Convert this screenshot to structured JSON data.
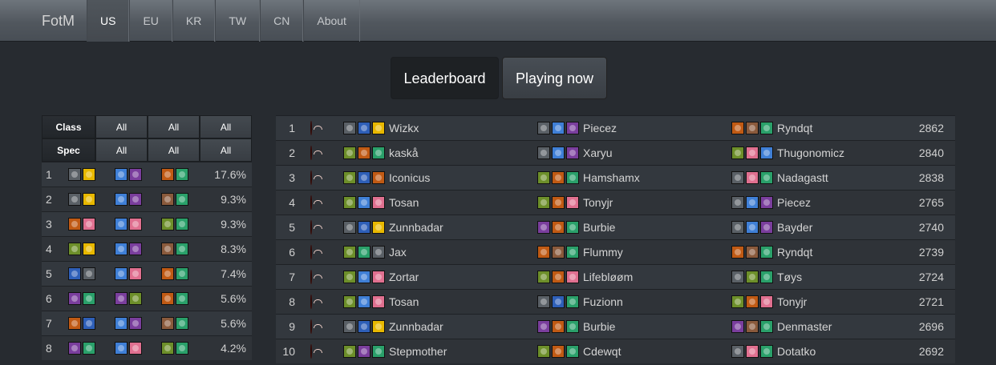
{
  "brand": "FotM",
  "nav": [
    {
      "label": "US",
      "active": true
    },
    {
      "label": "EU",
      "active": false
    },
    {
      "label": "KR",
      "active": false
    },
    {
      "label": "TW",
      "active": false
    },
    {
      "label": "CN",
      "active": false
    },
    {
      "label": "About",
      "active": false
    }
  ],
  "toggles": {
    "leaderboard": "Leaderboard",
    "playing_now": "Playing now"
  },
  "filters": {
    "class_label": "Class",
    "spec_label": "Spec",
    "class_opts": [
      "All",
      "All",
      "All"
    ],
    "spec_opts": [
      "All",
      "All",
      "All"
    ]
  },
  "colors": {
    "dk": "#5a6066",
    "rogue": "#e8b800",
    "hunter": "#6d8f2a",
    "mage": "#3f7fd6",
    "lock": "#7a3e9d",
    "priest": "#c8c8c8",
    "paladin": "#e07090",
    "druid": "#c05a14",
    "shaman": "#2e5fb8",
    "warrior": "#8a5a3c",
    "monk": "#2aa06a",
    "horde": "#8b1a14"
  },
  "comps": [
    {
      "rank": "1",
      "pct": "17.6%",
      "icons": [
        [
          "dk",
          "rogue"
        ],
        [
          "mage",
          "lock"
        ],
        [
          "druid",
          "monk"
        ]
      ]
    },
    {
      "rank": "2",
      "pct": "9.3%",
      "icons": [
        [
          "dk",
          "rogue"
        ],
        [
          "mage",
          "lock"
        ],
        [
          "warrior",
          "monk"
        ]
      ]
    },
    {
      "rank": "3",
      "pct": "9.3%",
      "icons": [
        [
          "druid",
          "paladin"
        ],
        [
          "mage",
          "paladin"
        ],
        [
          "hunter",
          "monk"
        ]
      ]
    },
    {
      "rank": "4",
      "pct": "8.3%",
      "icons": [
        [
          "hunter",
          "rogue"
        ],
        [
          "mage",
          "lock"
        ],
        [
          "warrior",
          "monk"
        ]
      ]
    },
    {
      "rank": "5",
      "pct": "7.4%",
      "icons": [
        [
          "shaman",
          "dk"
        ],
        [
          "mage",
          "paladin"
        ],
        [
          "druid",
          "monk"
        ]
      ]
    },
    {
      "rank": "6",
      "pct": "5.6%",
      "icons": [
        [
          "lock",
          "monk"
        ],
        [
          "lock",
          "hunter"
        ],
        [
          "druid",
          "monk"
        ]
      ]
    },
    {
      "rank": "7",
      "pct": "5.6%",
      "icons": [
        [
          "druid",
          "shaman"
        ],
        [
          "mage",
          "lock"
        ],
        [
          "warrior",
          "monk"
        ]
      ]
    },
    {
      "rank": "8",
      "pct": "4.2%",
      "icons": [
        [
          "lock",
          "monk"
        ],
        [
          "mage",
          "paladin"
        ],
        [
          "hunter",
          "monk"
        ]
      ]
    }
  ],
  "leaderboard": [
    {
      "rank": "1",
      "rating": "2862",
      "players": [
        {
          "name": "Wizkx",
          "icons": [
            "dk",
            "shaman",
            "rogue"
          ]
        },
        {
          "name": "Piecez",
          "icons": [
            "dk",
            "mage",
            "lock"
          ]
        },
        {
          "name": "Ryndqt",
          "icons": [
            "druid",
            "warrior",
            "monk"
          ]
        }
      ]
    },
    {
      "rank": "2",
      "rating": "2840",
      "players": [
        {
          "name": "kaskå",
          "icons": [
            "hunter",
            "druid",
            "monk"
          ]
        },
        {
          "name": "Xaryu",
          "icons": [
            "dk",
            "mage",
            "lock"
          ]
        },
        {
          "name": "Thugonomicz",
          "icons": [
            "hunter",
            "paladin",
            "mage"
          ]
        }
      ]
    },
    {
      "rank": "3",
      "rating": "2838",
      "players": [
        {
          "name": "Iconicus",
          "icons": [
            "hunter",
            "shaman",
            "druid"
          ]
        },
        {
          "name": "Hamshamx",
          "icons": [
            "hunter",
            "druid",
            "monk"
          ]
        },
        {
          "name": "Nadagastt",
          "icons": [
            "dk",
            "paladin",
            "monk"
          ]
        }
      ]
    },
    {
      "rank": "4",
      "rating": "2765",
      "players": [
        {
          "name": "Tosan",
          "icons": [
            "hunter",
            "mage",
            "paladin"
          ]
        },
        {
          "name": "Tonyjr",
          "icons": [
            "hunter",
            "druid",
            "paladin"
          ]
        },
        {
          "name": "Piecez",
          "icons": [
            "dk",
            "mage",
            "lock"
          ]
        }
      ]
    },
    {
      "rank": "5",
      "rating": "2740",
      "players": [
        {
          "name": "Zunnbadar",
          "icons": [
            "dk",
            "shaman",
            "rogue"
          ]
        },
        {
          "name": "Burbie",
          "icons": [
            "lock",
            "druid",
            "monk"
          ]
        },
        {
          "name": "Bayder",
          "icons": [
            "dk",
            "mage",
            "lock"
          ]
        }
      ]
    },
    {
      "rank": "6",
      "rating": "2739",
      "players": [
        {
          "name": "Jax",
          "icons": [
            "hunter",
            "monk",
            "dk"
          ]
        },
        {
          "name": "Flummy",
          "icons": [
            "druid",
            "warrior",
            "monk"
          ]
        },
        {
          "name": "Ryndqt",
          "icons": [
            "druid",
            "warrior",
            "monk"
          ]
        }
      ]
    },
    {
      "rank": "7",
      "rating": "2724",
      "players": [
        {
          "name": "Zortar",
          "icons": [
            "hunter",
            "mage",
            "paladin"
          ]
        },
        {
          "name": "Lifebløøm",
          "icons": [
            "hunter",
            "druid",
            "paladin"
          ]
        },
        {
          "name": "Tøys",
          "icons": [
            "dk",
            "hunter",
            "monk"
          ]
        }
      ]
    },
    {
      "rank": "8",
      "rating": "2721",
      "players": [
        {
          "name": "Tosan",
          "icons": [
            "hunter",
            "mage",
            "paladin"
          ]
        },
        {
          "name": "Fuzionn",
          "icons": [
            "dk",
            "shaman",
            "monk"
          ]
        },
        {
          "name": "Tonyjr",
          "icons": [
            "hunter",
            "druid",
            "paladin"
          ]
        }
      ]
    },
    {
      "rank": "9",
      "rating": "2696",
      "players": [
        {
          "name": "Zunnbadar",
          "icons": [
            "dk",
            "shaman",
            "rogue"
          ]
        },
        {
          "name": "Burbie",
          "icons": [
            "lock",
            "druid",
            "monk"
          ]
        },
        {
          "name": "Denmaster",
          "icons": [
            "lock",
            "warrior",
            "monk"
          ]
        }
      ]
    },
    {
      "rank": "10",
      "rating": "2692",
      "players": [
        {
          "name": "Stepmother",
          "icons": [
            "hunter",
            "lock",
            "monk"
          ]
        },
        {
          "name": "Cdewqt",
          "icons": [
            "hunter",
            "druid",
            "monk"
          ]
        },
        {
          "name": "Dotatko",
          "icons": [
            "dk",
            "paladin",
            "monk"
          ]
        }
      ]
    }
  ]
}
